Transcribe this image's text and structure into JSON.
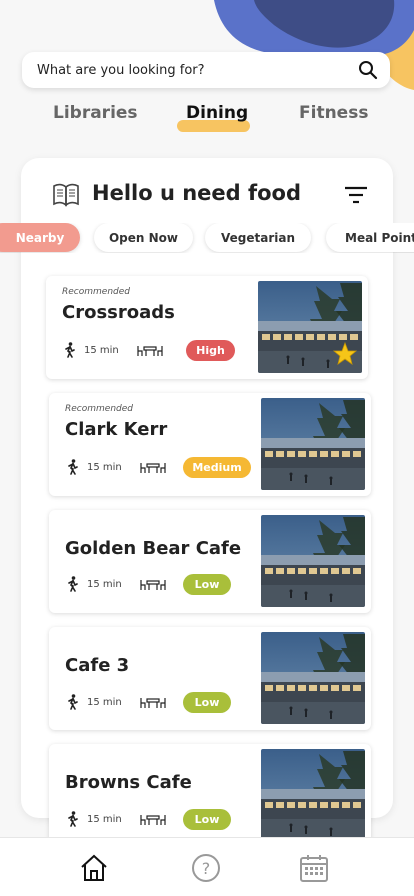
{
  "search": {
    "placeholder": "What are you looking for?",
    "icon": "search-icon"
  },
  "tabs": [
    {
      "label": "Libraries",
      "active": false
    },
    {
      "label": "Dining",
      "active": true
    },
    {
      "label": "Fitness",
      "active": false
    }
  ],
  "panel": {
    "title": "Hello u need food",
    "title_icon": "book-icon",
    "filter_icon": "filter-icon"
  },
  "filters": [
    {
      "label": "Nearby",
      "active": true
    },
    {
      "label": "Open Now",
      "active": false
    },
    {
      "label": "Vegetarian",
      "active": false
    },
    {
      "label": "Meal Points",
      "active": false
    }
  ],
  "places": [
    {
      "recommended": "Recommended",
      "name": "Crossroads",
      "time": "15 min",
      "crowd": "High",
      "crowd_color": "#e05a5a",
      "favorite": true
    },
    {
      "recommended": "Recommended",
      "name": "Clark Kerr",
      "time": "15 min",
      "crowd": "Medium",
      "crowd_color": "#f5b833",
      "favorite": false
    },
    {
      "recommended": "",
      "name": "Golden Bear Cafe",
      "time": "15 min",
      "crowd": "Low",
      "crowd_color": "#a9bf3a",
      "favorite": false
    },
    {
      "recommended": "",
      "name": "Cafe 3",
      "time": "15 min",
      "crowd": "Low",
      "crowd_color": "#a9bf3a",
      "favorite": false
    },
    {
      "recommended": "",
      "name": "Browns Cafe",
      "time": "15 min",
      "crowd": "Low",
      "crowd_color": "#a9bf3a",
      "favorite": false
    }
  ],
  "bottom_nav": [
    {
      "icon": "home-icon",
      "active": true
    },
    {
      "icon": "help-icon",
      "active": false
    },
    {
      "icon": "calendar-icon",
      "active": false
    }
  ],
  "colors": {
    "accent_yellow": "#f7c461",
    "blob_blue": "#5a72c9",
    "blob_navy": "#3e4d86",
    "nearby_chip": "#f29b8f"
  }
}
